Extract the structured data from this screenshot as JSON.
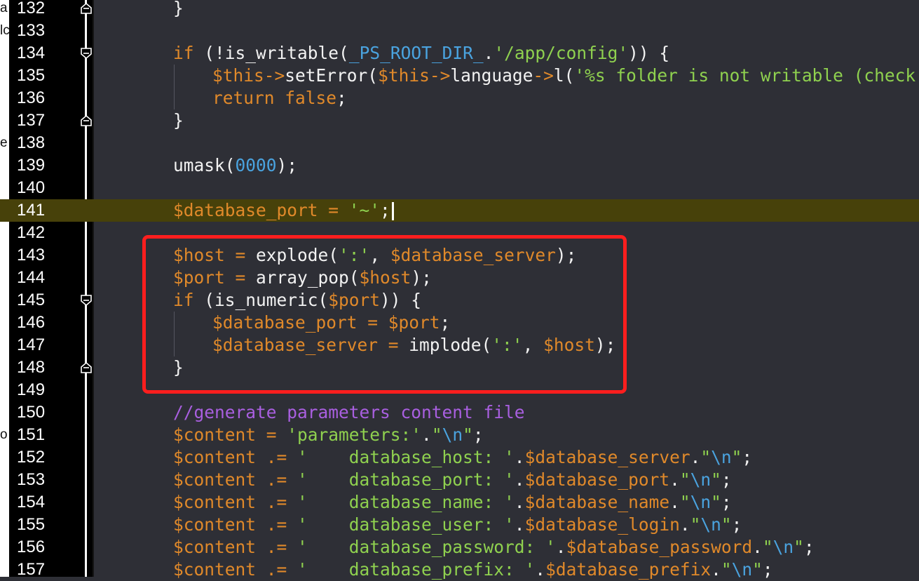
{
  "colors": {
    "background": "#2e2f36",
    "gutter": "#000000",
    "line_number": "#ffffff",
    "current_line": "#47410a",
    "keyword": "#e0892a",
    "variable": "#e0892a",
    "string": "#8fd14f",
    "number": "#4aa3df",
    "comment": "#a95fe0",
    "escape": "#4aa3df",
    "plain": "#f2f2f2",
    "highlight_box": "#ff1e1e"
  },
  "left_strip_fragments": [
    {
      "text": "a",
      "row": 0
    },
    {
      "text": "lc",
      "row": 1
    },
    {
      "text": "e",
      "row": 6
    },
    {
      "text": "o",
      "row": 19
    }
  ],
  "active_line": 141,
  "lines": [
    {
      "num": "132",
      "fold": "end",
      "indent": 0,
      "tokens": [
        {
          "t": "}",
          "c": "plain"
        }
      ]
    },
    {
      "num": "133",
      "indent": 0,
      "tokens": []
    },
    {
      "num": "134",
      "fold": "start",
      "indent": 0,
      "tokens": [
        {
          "t": "if",
          "c": "keyword"
        },
        {
          "t": " (!",
          "c": "plain"
        },
        {
          "t": "is_writable",
          "c": "plain"
        },
        {
          "t": "(",
          "c": "plain"
        },
        {
          "t": "_PS_ROOT_DIR_",
          "c": "constant"
        },
        {
          "t": ".",
          "c": "plain"
        },
        {
          "t": "'/app/config'",
          "c": "string"
        },
        {
          "t": ")) {",
          "c": "plain"
        }
      ]
    },
    {
      "num": "135",
      "indent": 1,
      "tokens": [
        {
          "t": "$this",
          "c": "variable"
        },
        {
          "t": "->",
          "c": "keyword"
        },
        {
          "t": "setError",
          "c": "plain"
        },
        {
          "t": "(",
          "c": "plain"
        },
        {
          "t": "$this",
          "c": "variable"
        },
        {
          "t": "->",
          "c": "keyword"
        },
        {
          "t": "language",
          "c": "plain"
        },
        {
          "t": "->",
          "c": "keyword"
        },
        {
          "t": "l",
          "c": "plain"
        },
        {
          "t": "(",
          "c": "plain"
        },
        {
          "t": "'%s folder is not writable (check per",
          "c": "string"
        }
      ]
    },
    {
      "num": "136",
      "indent": 1,
      "tokens": [
        {
          "t": "return",
          "c": "keyword"
        },
        {
          "t": " ",
          "c": "plain"
        },
        {
          "t": "false",
          "c": "keyword"
        },
        {
          "t": ";",
          "c": "plain"
        }
      ]
    },
    {
      "num": "137",
      "fold": "end",
      "indent": 0,
      "tokens": [
        {
          "t": "}",
          "c": "plain"
        }
      ]
    },
    {
      "num": "138",
      "indent": 0,
      "tokens": []
    },
    {
      "num": "139",
      "indent": 0,
      "tokens": [
        {
          "t": "umask(",
          "c": "plain"
        },
        {
          "t": "0000",
          "c": "number"
        },
        {
          "t": ");",
          "c": "plain"
        }
      ]
    },
    {
      "num": "140",
      "indent": 0,
      "tokens": []
    },
    {
      "num": "141",
      "indent": 0,
      "cursor": true,
      "tokens": [
        {
          "t": "$database_port",
          "c": "variable"
        },
        {
          "t": " = ",
          "c": "keyword"
        },
        {
          "t": "'~'",
          "c": "string"
        },
        {
          "t": ";",
          "c": "plain"
        }
      ]
    },
    {
      "num": "142",
      "indent": 0,
      "tokens": []
    },
    {
      "num": "143",
      "indent": 0,
      "tokens": [
        {
          "t": "$host",
          "c": "variable"
        },
        {
          "t": " = ",
          "c": "keyword"
        },
        {
          "t": "explode(",
          "c": "plain"
        },
        {
          "t": "':'",
          "c": "string"
        },
        {
          "t": ", ",
          "c": "plain"
        },
        {
          "t": "$database_server",
          "c": "variable"
        },
        {
          "t": ");",
          "c": "plain"
        }
      ]
    },
    {
      "num": "144",
      "indent": 0,
      "tokens": [
        {
          "t": "$port",
          "c": "variable"
        },
        {
          "t": " = ",
          "c": "keyword"
        },
        {
          "t": "array_pop(",
          "c": "plain"
        },
        {
          "t": "$host",
          "c": "variable"
        },
        {
          "t": ");",
          "c": "plain"
        }
      ]
    },
    {
      "num": "145",
      "fold": "start",
      "indent": 0,
      "tokens": [
        {
          "t": "if",
          "c": "keyword"
        },
        {
          "t": " (is_numeric(",
          "c": "plain"
        },
        {
          "t": "$port",
          "c": "variable"
        },
        {
          "t": ")) {",
          "c": "plain"
        }
      ]
    },
    {
      "num": "146",
      "indent": 1,
      "tokens": [
        {
          "t": "$database_port",
          "c": "variable"
        },
        {
          "t": " = ",
          "c": "keyword"
        },
        {
          "t": "$port",
          "c": "variable"
        },
        {
          "t": ";",
          "c": "plain"
        }
      ]
    },
    {
      "num": "147",
      "indent": 1,
      "tokens": [
        {
          "t": "$database_server",
          "c": "variable"
        },
        {
          "t": " = ",
          "c": "keyword"
        },
        {
          "t": "implode(",
          "c": "plain"
        },
        {
          "t": "':'",
          "c": "string"
        },
        {
          "t": ", ",
          "c": "plain"
        },
        {
          "t": "$host",
          "c": "variable"
        },
        {
          "t": ");",
          "c": "plain"
        }
      ]
    },
    {
      "num": "148",
      "fold": "end",
      "indent": 0,
      "tokens": [
        {
          "t": "}",
          "c": "plain"
        }
      ]
    },
    {
      "num": "149",
      "indent": 0,
      "tokens": []
    },
    {
      "num": "150",
      "indent": 0,
      "tokens": [
        {
          "t": "//generate parameters content file",
          "c": "comment"
        }
      ]
    },
    {
      "num": "151",
      "indent": 0,
      "tokens": [
        {
          "t": "$content",
          "c": "variable"
        },
        {
          "t": " = ",
          "c": "keyword"
        },
        {
          "t": "'parameters:'",
          "c": "string"
        },
        {
          "t": ".",
          "c": "plain"
        },
        {
          "t": "\"",
          "c": "string"
        },
        {
          "t": "\\n",
          "c": "escape"
        },
        {
          "t": "\"",
          "c": "string"
        },
        {
          "t": ";",
          "c": "plain"
        }
      ]
    },
    {
      "num": "152",
      "indent": 0,
      "tokens": [
        {
          "t": "$content",
          "c": "variable"
        },
        {
          "t": " .= ",
          "c": "keyword"
        },
        {
          "t": "'    database_host: '",
          "c": "string"
        },
        {
          "t": ".",
          "c": "plain"
        },
        {
          "t": "$database_server",
          "c": "variable"
        },
        {
          "t": ".",
          "c": "plain"
        },
        {
          "t": "\"",
          "c": "string"
        },
        {
          "t": "\\n",
          "c": "escape"
        },
        {
          "t": "\"",
          "c": "string"
        },
        {
          "t": ";",
          "c": "plain"
        }
      ]
    },
    {
      "num": "153",
      "indent": 0,
      "tokens": [
        {
          "t": "$content",
          "c": "variable"
        },
        {
          "t": " .= ",
          "c": "keyword"
        },
        {
          "t": "'    database_port: '",
          "c": "string"
        },
        {
          "t": ".",
          "c": "plain"
        },
        {
          "t": "$database_port",
          "c": "variable"
        },
        {
          "t": ".",
          "c": "plain"
        },
        {
          "t": "\"",
          "c": "string"
        },
        {
          "t": "\\n",
          "c": "escape"
        },
        {
          "t": "\"",
          "c": "string"
        },
        {
          "t": ";",
          "c": "plain"
        }
      ]
    },
    {
      "num": "154",
      "indent": 0,
      "tokens": [
        {
          "t": "$content",
          "c": "variable"
        },
        {
          "t": " .= ",
          "c": "keyword"
        },
        {
          "t": "'    database_name: '",
          "c": "string"
        },
        {
          "t": ".",
          "c": "plain"
        },
        {
          "t": "$database_name",
          "c": "variable"
        },
        {
          "t": ".",
          "c": "plain"
        },
        {
          "t": "\"",
          "c": "string"
        },
        {
          "t": "\\n",
          "c": "escape"
        },
        {
          "t": "\"",
          "c": "string"
        },
        {
          "t": ";",
          "c": "plain"
        }
      ]
    },
    {
      "num": "155",
      "indent": 0,
      "tokens": [
        {
          "t": "$content",
          "c": "variable"
        },
        {
          "t": " .= ",
          "c": "keyword"
        },
        {
          "t": "'    database_user: '",
          "c": "string"
        },
        {
          "t": ".",
          "c": "plain"
        },
        {
          "t": "$database_login",
          "c": "variable"
        },
        {
          "t": ".",
          "c": "plain"
        },
        {
          "t": "\"",
          "c": "string"
        },
        {
          "t": "\\n",
          "c": "escape"
        },
        {
          "t": "\"",
          "c": "string"
        },
        {
          "t": ";",
          "c": "plain"
        }
      ]
    },
    {
      "num": "156",
      "indent": 0,
      "tokens": [
        {
          "t": "$content",
          "c": "variable"
        },
        {
          "t": " .= ",
          "c": "keyword"
        },
        {
          "t": "'    database_password: '",
          "c": "string"
        },
        {
          "t": ".",
          "c": "plain"
        },
        {
          "t": "$database_password",
          "c": "variable"
        },
        {
          "t": ".",
          "c": "plain"
        },
        {
          "t": "\"",
          "c": "string"
        },
        {
          "t": "\\n",
          "c": "escape"
        },
        {
          "t": "\"",
          "c": "string"
        },
        {
          "t": ";",
          "c": "plain"
        }
      ]
    },
    {
      "num": "157",
      "indent": 0,
      "tokens": [
        {
          "t": "$content",
          "c": "variable"
        },
        {
          "t": " .= ",
          "c": "keyword"
        },
        {
          "t": "'    database_prefix: '",
          "c": "string"
        },
        {
          "t": ".",
          "c": "plain"
        },
        {
          "t": "$database_prefix",
          "c": "variable"
        },
        {
          "t": ".",
          "c": "plain"
        },
        {
          "t": "\"",
          "c": "string"
        },
        {
          "t": "\\n",
          "c": "escape"
        },
        {
          "t": "\"",
          "c": "string"
        },
        {
          "t": ";",
          "c": "plain"
        }
      ]
    }
  ]
}
